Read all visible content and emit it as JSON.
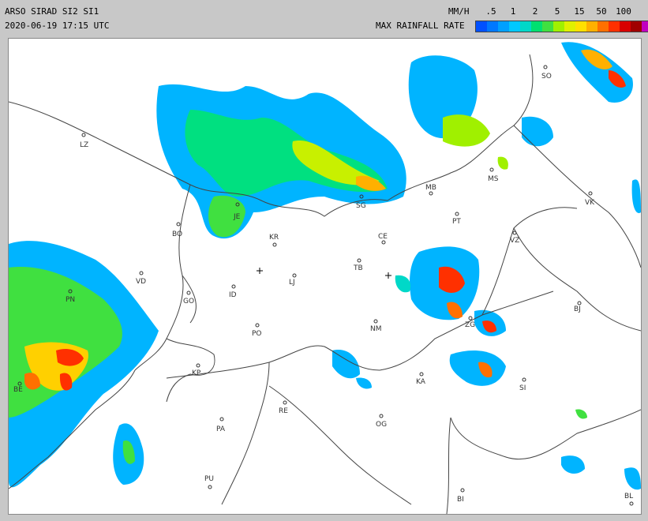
{
  "header": {
    "product": "ARSO SIRAD SI2 SI1",
    "timestamp": "2020-06-19 17:15 UTC",
    "units": "MM/H",
    "scale_title": "MAX RAINFALL RATE"
  },
  "scale": {
    "labels": [
      ".5",
      "1",
      "2",
      "5",
      "15",
      "50",
      "100"
    ],
    "colors": [
      "#0050ff",
      "#0078ff",
      "#00a0ff",
      "#00c8ff",
      "#00d8c8",
      "#00e070",
      "#40e040",
      "#a0f000",
      "#e0f000",
      "#ffe000",
      "#ffb000",
      "#ff7000",
      "#ff3000",
      "#d80000",
      "#a00000",
      "#c000c0"
    ]
  },
  "map": {
    "cities": [
      {
        "code": "SO"
      },
      {
        "code": "LZ"
      },
      {
        "code": "MS"
      },
      {
        "code": "MB"
      },
      {
        "code": "VK"
      },
      {
        "code": "SG"
      },
      {
        "code": "PT"
      },
      {
        "code": "JE"
      },
      {
        "code": "BO"
      },
      {
        "code": "KR"
      },
      {
        "code": "CE"
      },
      {
        "code": "VZ"
      },
      {
        "code": "TB"
      },
      {
        "code": "VD"
      },
      {
        "code": "LJ"
      },
      {
        "code": "PN"
      },
      {
        "code": "ID"
      },
      {
        "code": "GO"
      },
      {
        "code": "BJ"
      },
      {
        "code": "ZG"
      },
      {
        "code": "NM"
      },
      {
        "code": "PO"
      },
      {
        "code": "KP"
      },
      {
        "code": "KA"
      },
      {
        "code": "SI"
      },
      {
        "code": "BE"
      },
      {
        "code": "RE"
      },
      {
        "code": "PA"
      },
      {
        "code": "OG"
      },
      {
        "code": "PU"
      },
      {
        "code": "BI"
      },
      {
        "code": "BL"
      }
    ]
  }
}
